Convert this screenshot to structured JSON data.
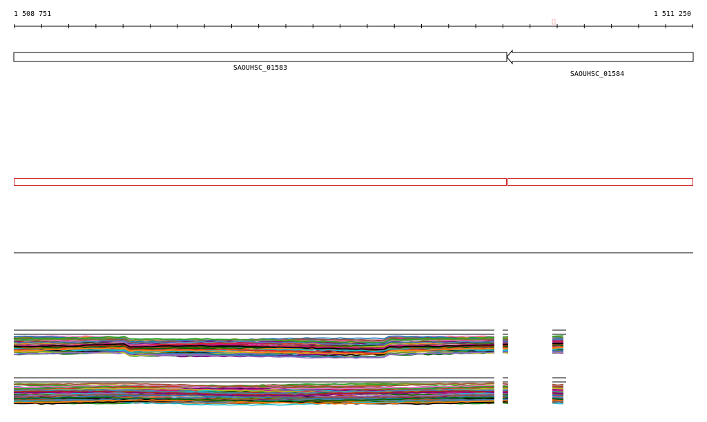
{
  "ruler": {
    "start_label": "1 508 751",
    "end_label": "1 511 250",
    "start": 1508751,
    "end": 1511250,
    "marker_color": "#f4b6b6"
  },
  "genes": [
    {
      "name": "SAOUHSC_01583",
      "strand": "+"
    },
    {
      "name": "SAOUHSC_01584",
      "strand": "-"
    }
  ],
  "region_color": "#d42a2a",
  "track_colors": [
    "#000000",
    "#d62728",
    "#2ca02c",
    "#1f77b4",
    "#ff7f0e",
    "#9467bd",
    "#8c564b",
    "#e377c2",
    "#bcbd22",
    "#17becf",
    "#7f7f00",
    "#a0522d",
    "#006400",
    "#800080",
    "#b22222",
    "#4682b4",
    "#6b8e23",
    "#c71585"
  ]
}
